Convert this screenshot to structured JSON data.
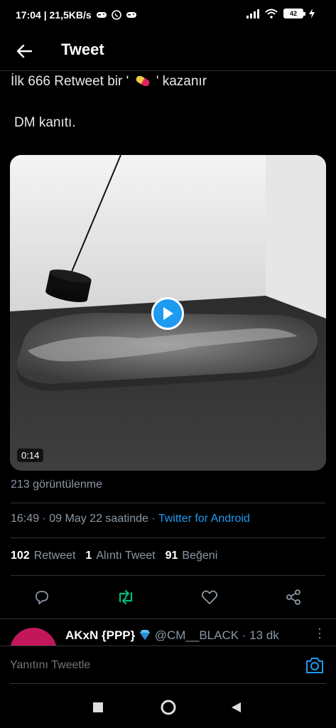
{
  "status_bar": {
    "time_info": "17:04 | 21,5KB/s",
    "battery": "42"
  },
  "header": {
    "title": "Tweet"
  },
  "tweet": {
    "line1_before": "İlk 666 Retweet bir '",
    "line1_after": "' kazanır",
    "line2": "DM kanıtı.",
    "media_duration": "0:14",
    "views": "213 görüntülenme",
    "time": "16:49 · 09 May 22 saatinde ·",
    "source": "Twitter for Android",
    "stats": {
      "retweets_count": "102",
      "retweets_label": "Retweet",
      "quotes_count": "1",
      "quotes_label": "Alıntı Tweet",
      "likes_count": "91",
      "likes_label": "Beğeni"
    }
  },
  "reply_preview": {
    "name": "AKxN {PPP}",
    "handle_time": "@CM__BLACK · 13 dk"
  },
  "compose": {
    "placeholder": "Yanıtını Tweetle"
  },
  "icons": {
    "back": "arrow-left-icon",
    "reply": "reply-icon",
    "retweet": "retweet-icon",
    "like": "heart-icon",
    "share": "share-icon",
    "camera": "camera-icon"
  },
  "colors": {
    "accent": "#1d9bf0",
    "retweet_green": "#00ba7c",
    "muted": "#8b98a5"
  }
}
